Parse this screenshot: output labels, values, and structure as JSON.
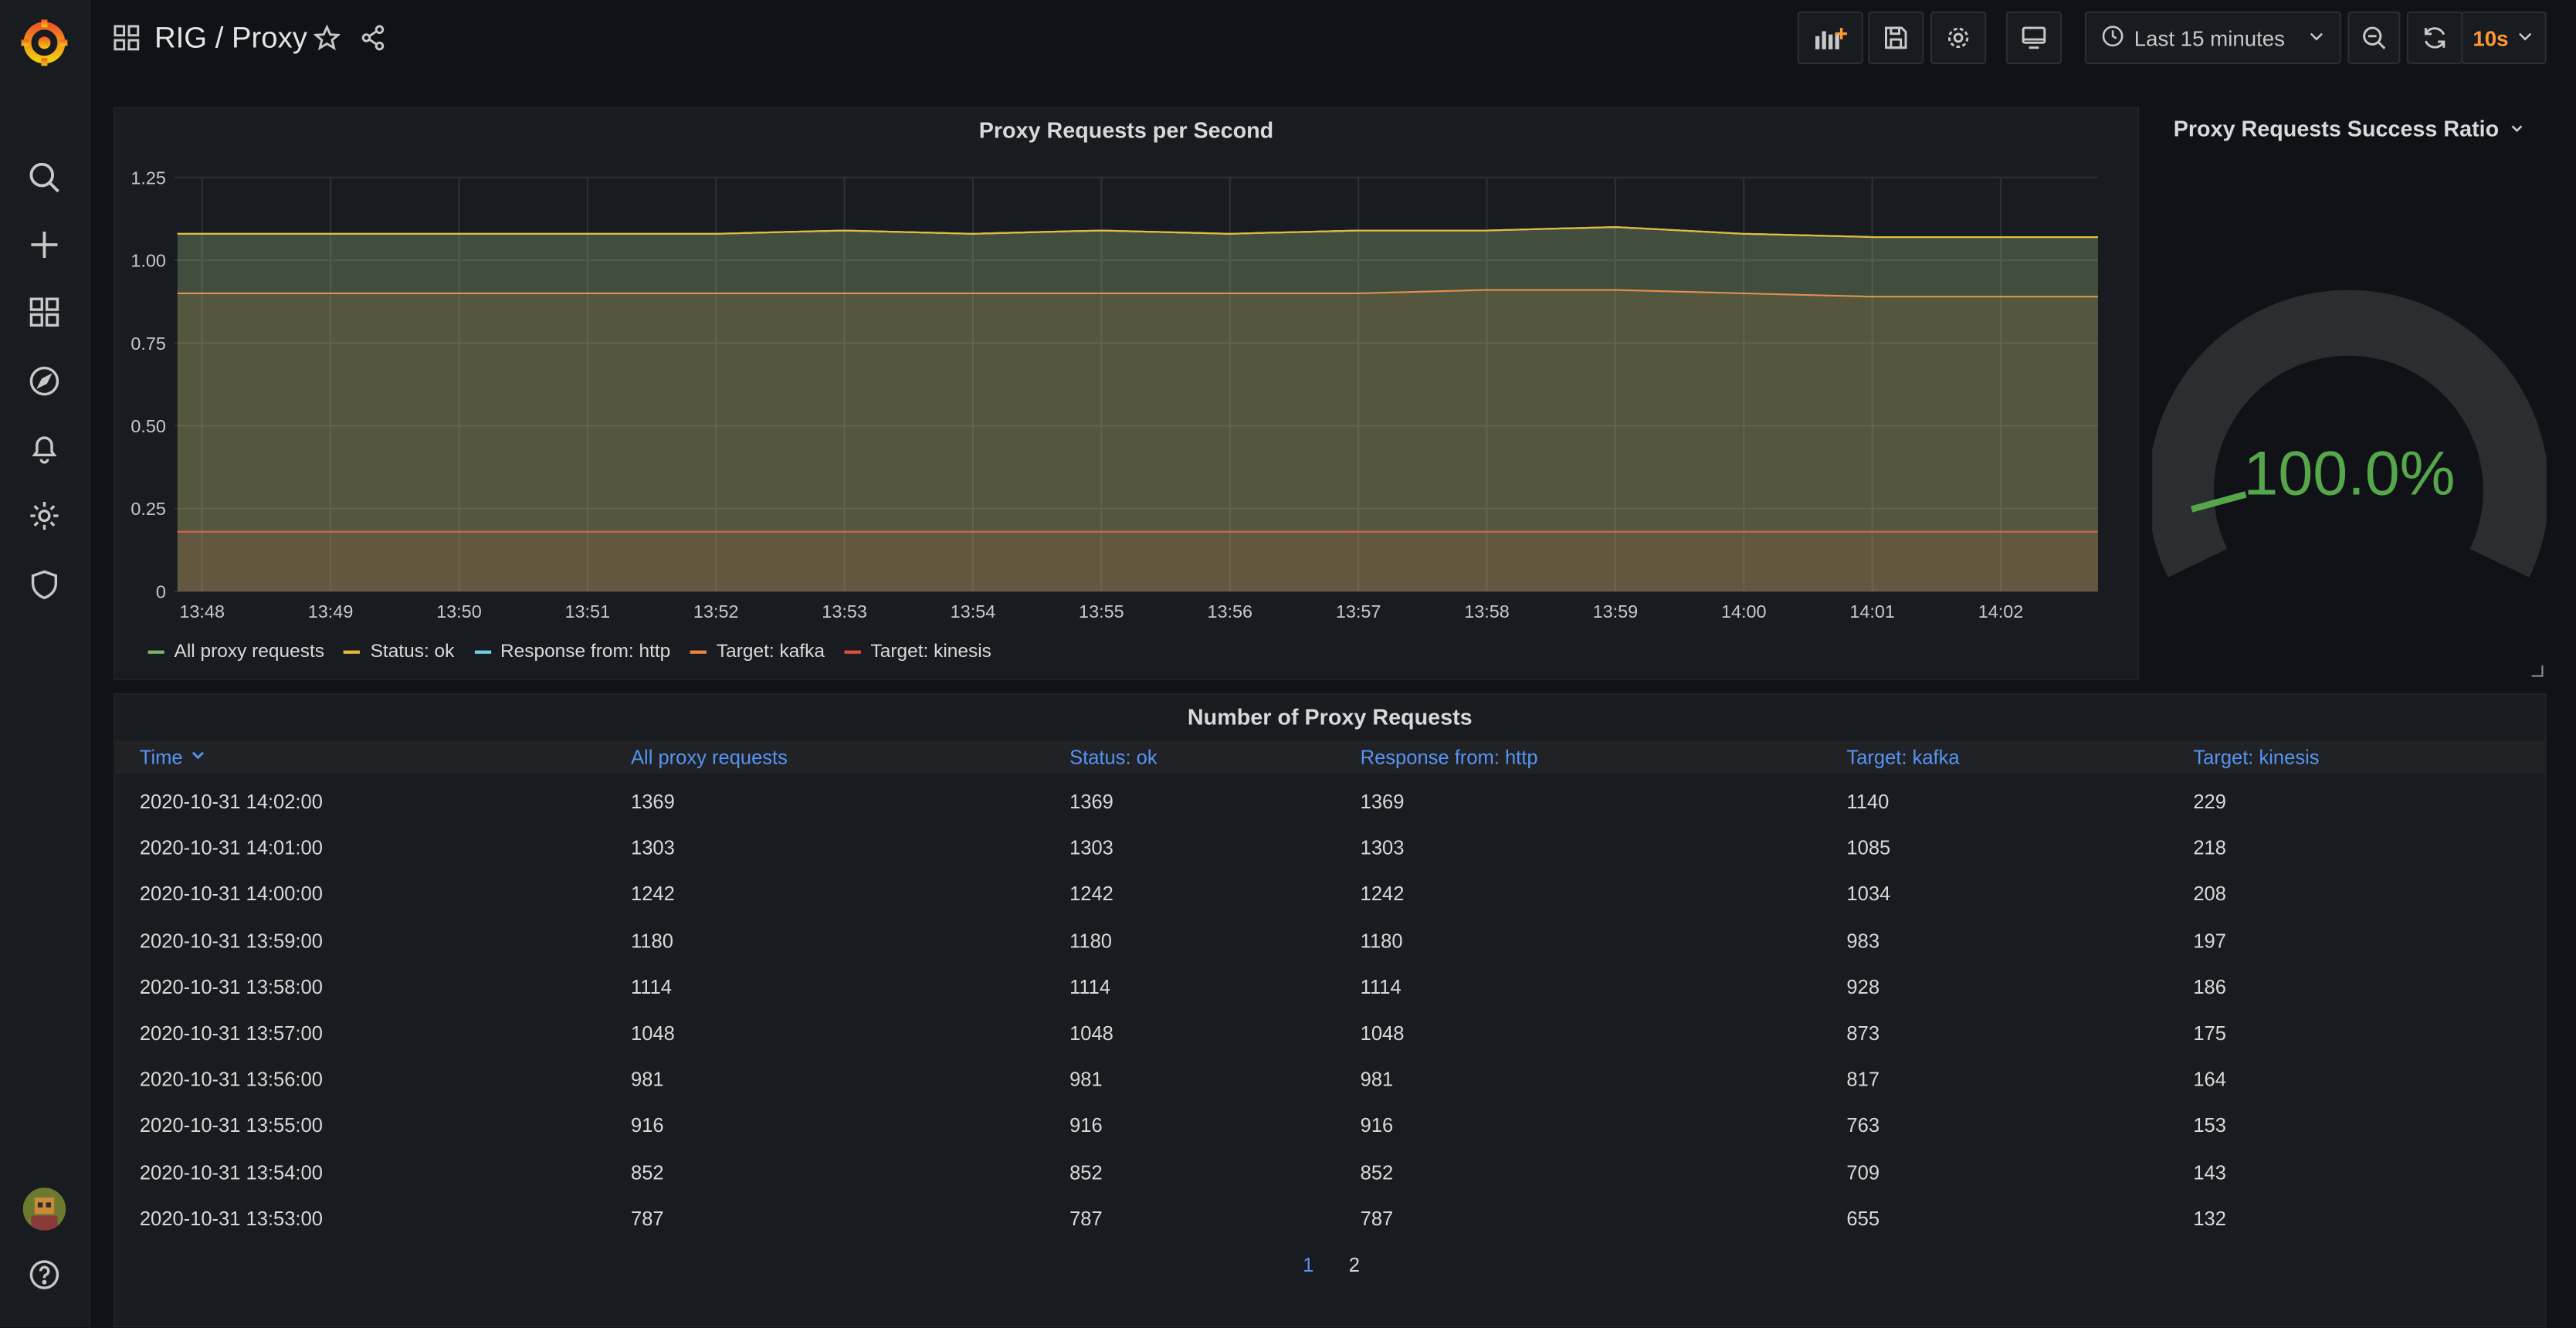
{
  "header": {
    "title": "RIG / Proxy",
    "time_range": "Last 15 minutes",
    "refresh": "10s"
  },
  "colors": {
    "background": "#111217",
    "panel": "#181b1f",
    "accent_blue": "#5794f2",
    "gauge_green": "#56a64b",
    "series_all": "#7eb26d",
    "series_ok": "#eab839",
    "series_http": "#6ed0e0",
    "series_kafka": "#ef843c",
    "series_kinesis": "#e24d42"
  },
  "timeseries_panel": {
    "title": "Proxy Requests per Second",
    "y_ticks": [
      "1.25",
      "1.00",
      "0.75",
      "0.50",
      "0.25",
      "0"
    ],
    "x_ticks": [
      "13:48",
      "13:49",
      "13:50",
      "13:51",
      "13:52",
      "13:53",
      "13:54",
      "13:55",
      "13:56",
      "13:57",
      "13:58",
      "13:59",
      "14:00",
      "14:01",
      "14:02"
    ],
    "legend": [
      {
        "label": "All proxy requests",
        "color": "#7eb26d"
      },
      {
        "label": "Status: ok",
        "color": "#eab839"
      },
      {
        "label": "Response from: http",
        "color": "#6ed0e0"
      },
      {
        "label": "Target: kafka",
        "color": "#ef843c"
      },
      {
        "label": "Target: kinesis",
        "color": "#e24d42"
      }
    ]
  },
  "chart_data": {
    "type": "area",
    "ylim": [
      0,
      1.25
    ],
    "x": [
      "13:48",
      "13:49",
      "13:50",
      "13:51",
      "13:52",
      "13:53",
      "13:54",
      "13:55",
      "13:56",
      "13:57",
      "13:58",
      "13:59",
      "14:00",
      "14:01",
      "14:02"
    ],
    "series": [
      {
        "name": "All proxy requests",
        "values": [
          1.08,
          1.08,
          1.08,
          1.08,
          1.08,
          1.09,
          1.08,
          1.09,
          1.08,
          1.09,
          1.09,
          1.1,
          1.08,
          1.07,
          1.07
        ]
      },
      {
        "name": "Status: ok",
        "values": [
          1.08,
          1.08,
          1.08,
          1.08,
          1.08,
          1.09,
          1.08,
          1.09,
          1.08,
          1.09,
          1.09,
          1.1,
          1.08,
          1.07,
          1.07
        ]
      },
      {
        "name": "Response from: http",
        "values": [
          1.08,
          1.08,
          1.08,
          1.08,
          1.08,
          1.09,
          1.08,
          1.09,
          1.08,
          1.09,
          1.09,
          1.1,
          1.08,
          1.07,
          1.07
        ]
      },
      {
        "name": "Target: kafka",
        "values": [
          0.9,
          0.9,
          0.9,
          0.9,
          0.9,
          0.9,
          0.9,
          0.9,
          0.9,
          0.9,
          0.91,
          0.91,
          0.9,
          0.89,
          0.89
        ]
      },
      {
        "name": "Target: kinesis",
        "values": [
          0.18,
          0.18,
          0.18,
          0.18,
          0.18,
          0.18,
          0.18,
          0.18,
          0.18,
          0.18,
          0.18,
          0.18,
          0.18,
          0.18,
          0.18
        ]
      }
    ]
  },
  "gauge_panel": {
    "title": "Proxy Requests Success Ratio",
    "value_text": "100.0%",
    "value": 1.0
  },
  "table_panel": {
    "title": "Number of Proxy Requests",
    "columns": [
      "Time",
      "All proxy requests",
      "Status: ok",
      "Response from: http",
      "Target: kafka",
      "Target: kinesis"
    ],
    "rows": [
      [
        "2020-10-31 14:02:00",
        "1369",
        "1369",
        "1369",
        "1140",
        "229"
      ],
      [
        "2020-10-31 14:01:00",
        "1303",
        "1303",
        "1303",
        "1085",
        "218"
      ],
      [
        "2020-10-31 14:00:00",
        "1242",
        "1242",
        "1242",
        "1034",
        "208"
      ],
      [
        "2020-10-31 13:59:00",
        "1180",
        "1180",
        "1180",
        "983",
        "197"
      ],
      [
        "2020-10-31 13:58:00",
        "1114",
        "1114",
        "1114",
        "928",
        "186"
      ],
      [
        "2020-10-31 13:57:00",
        "1048",
        "1048",
        "1048",
        "873",
        "175"
      ],
      [
        "2020-10-31 13:56:00",
        "981",
        "981",
        "981",
        "817",
        "164"
      ],
      [
        "2020-10-31 13:55:00",
        "916",
        "916",
        "916",
        "763",
        "153"
      ],
      [
        "2020-10-31 13:54:00",
        "852",
        "852",
        "852",
        "709",
        "143"
      ],
      [
        "2020-10-31 13:53:00",
        "787",
        "787",
        "787",
        "655",
        "132"
      ]
    ],
    "pages": [
      "1",
      "2"
    ],
    "current_page": "1"
  }
}
